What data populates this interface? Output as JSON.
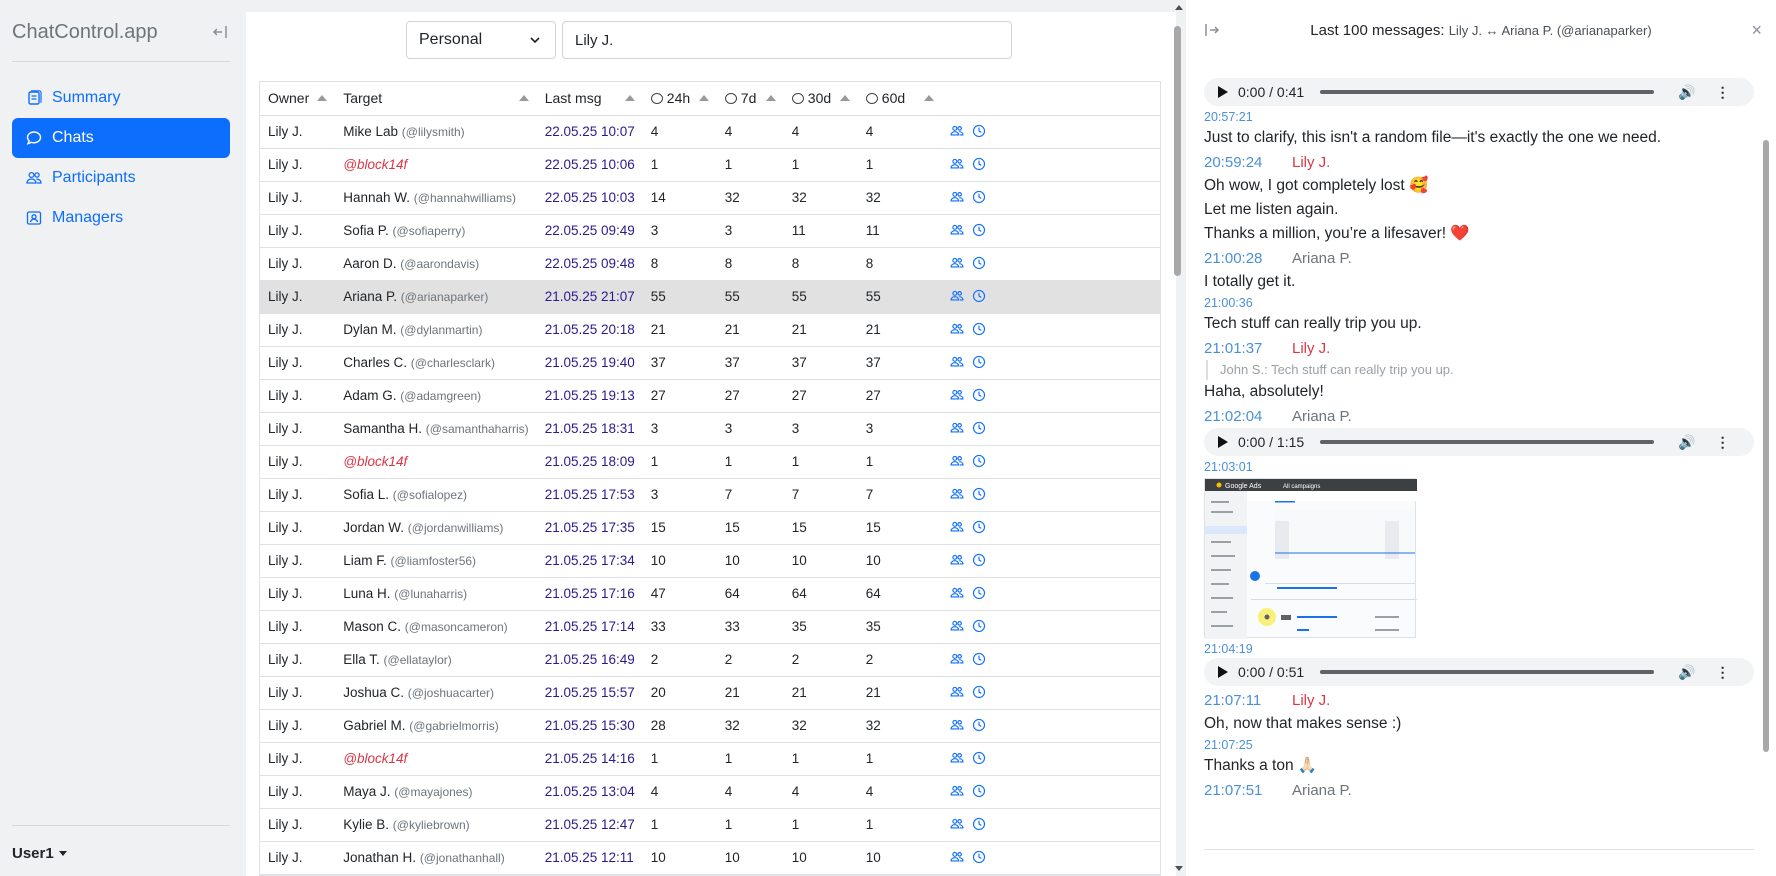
{
  "app": {
    "brand": "ChatControl.app",
    "user": "User1"
  },
  "nav": [
    {
      "label": "Summary",
      "icon": "summary-icon",
      "active": false
    },
    {
      "label": "Chats",
      "icon": "chat-icon",
      "active": true
    },
    {
      "label": "Participants",
      "icon": "participants-icon",
      "active": false
    },
    {
      "label": "Managers",
      "icon": "managers-icon",
      "active": false
    }
  ],
  "filters": {
    "type_value": "Personal",
    "owner_value": "Lily J."
  },
  "table": {
    "headers": {
      "owner": "Owner",
      "target": "Target",
      "last": "Last msg",
      "h24": "24h",
      "d7": "7d",
      "d30": "30d",
      "d60": "60d"
    },
    "rows": [
      {
        "owner": "Lily J.",
        "name": "Mike Lab",
        "handle": "(@lilysmith)",
        "blocked": false,
        "last": "22.05.25 10:07",
        "h24": "4",
        "d7": "4",
        "d30": "4",
        "d60": "4"
      },
      {
        "owner": "Lily J.",
        "name": "@block14f",
        "handle": "",
        "blocked": true,
        "last": "22.05.25 10:06",
        "h24": "1",
        "d7": "1",
        "d30": "1",
        "d60": "1"
      },
      {
        "owner": "Lily J.",
        "name": "Hannah W.",
        "handle": "(@hannahwilliams)",
        "blocked": false,
        "last": "22.05.25 10:03",
        "h24": "14",
        "d7": "32",
        "d30": "32",
        "d60": "32"
      },
      {
        "owner": "Lily J.",
        "name": "Sofia P.",
        "handle": "(@sofiaperry)",
        "blocked": false,
        "last": "22.05.25 09:49",
        "h24": "3",
        "d7": "3",
        "d30": "11",
        "d60": "11"
      },
      {
        "owner": "Lily J.",
        "name": "Aaron D.",
        "handle": "(@aarondavis)",
        "blocked": false,
        "last": "22.05.25 09:48",
        "h24": "8",
        "d7": "8",
        "d30": "8",
        "d60": "8"
      },
      {
        "owner": "Lily J.",
        "name": "Ariana P.",
        "handle": "(@arianaparker)",
        "blocked": false,
        "last": "21.05.25 21:07",
        "h24": "55",
        "d7": "55",
        "d30": "55",
        "d60": "55",
        "selected": true
      },
      {
        "owner": "Lily J.",
        "name": "Dylan M.",
        "handle": "(@dylanmartin)",
        "blocked": false,
        "last": "21.05.25 20:18",
        "h24": "21",
        "d7": "21",
        "d30": "21",
        "d60": "21"
      },
      {
        "owner": "Lily J.",
        "name": "Charles C.",
        "handle": "(@charlesclark)",
        "blocked": false,
        "last": "21.05.25 19:40",
        "h24": "37",
        "d7": "37",
        "d30": "37",
        "d60": "37"
      },
      {
        "owner": "Lily J.",
        "name": "Adam G.",
        "handle": "(@adamgreen)",
        "blocked": false,
        "last": "21.05.25 19:13",
        "h24": "27",
        "d7": "27",
        "d30": "27",
        "d60": "27"
      },
      {
        "owner": "Lily J.",
        "name": "Samantha H.",
        "handle": "(@samanthaharris)",
        "blocked": false,
        "last": "21.05.25 18:31",
        "h24": "3",
        "d7": "3",
        "d30": "3",
        "d60": "3"
      },
      {
        "owner": "Lily J.",
        "name": "@block14f",
        "handle": "",
        "blocked": true,
        "last": "21.05.25 18:09",
        "h24": "1",
        "d7": "1",
        "d30": "1",
        "d60": "1"
      },
      {
        "owner": "Lily J.",
        "name": "Sofia L.",
        "handle": "(@sofialopez)",
        "blocked": false,
        "last": "21.05.25 17:53",
        "h24": "3",
        "d7": "7",
        "d30": "7",
        "d60": "7"
      },
      {
        "owner": "Lily J.",
        "name": "Jordan W.",
        "handle": "(@jordanwilliams)",
        "blocked": false,
        "last": "21.05.25 17:35",
        "h24": "15",
        "d7": "15",
        "d30": "15",
        "d60": "15"
      },
      {
        "owner": "Lily J.",
        "name": "Liam F.",
        "handle": "(@liamfoster56)",
        "blocked": false,
        "last": "21.05.25 17:34",
        "h24": "10",
        "d7": "10",
        "d30": "10",
        "d60": "10"
      },
      {
        "owner": "Lily J.",
        "name": "Luna H.",
        "handle": "(@lunaharris)",
        "blocked": false,
        "last": "21.05.25 17:16",
        "h24": "47",
        "d7": "64",
        "d30": "64",
        "d60": "64"
      },
      {
        "owner": "Lily J.",
        "name": "Mason C.",
        "handle": "(@masoncameron)",
        "blocked": false,
        "last": "21.05.25 17:14",
        "h24": "33",
        "d7": "33",
        "d30": "35",
        "d60": "35"
      },
      {
        "owner": "Lily J.",
        "name": "Ella T.",
        "handle": "(@ellataylor)",
        "blocked": false,
        "last": "21.05.25 16:49",
        "h24": "2",
        "d7": "2",
        "d30": "2",
        "d60": "2"
      },
      {
        "owner": "Lily J.",
        "name": "Joshua C.",
        "handle": "(@joshuacarter)",
        "blocked": false,
        "last": "21.05.25 15:57",
        "h24": "20",
        "d7": "21",
        "d30": "21",
        "d60": "21"
      },
      {
        "owner": "Lily J.",
        "name": "Gabriel M.",
        "handle": "(@gabrielmorris)",
        "blocked": false,
        "last": "21.05.25 15:30",
        "h24": "28",
        "d7": "32",
        "d30": "32",
        "d60": "32"
      },
      {
        "owner": "Lily J.",
        "name": "@block14f",
        "handle": "",
        "blocked": true,
        "last": "21.05.25 14:16",
        "h24": "1",
        "d7": "1",
        "d30": "1",
        "d60": "1"
      },
      {
        "owner": "Lily J.",
        "name": "Maya J.",
        "handle": "(@mayajones)",
        "blocked": false,
        "last": "21.05.25 13:04",
        "h24": "4",
        "d7": "4",
        "d30": "4",
        "d60": "4"
      },
      {
        "owner": "Lily J.",
        "name": "Kylie B.",
        "handle": "(@kyliebrown)",
        "blocked": false,
        "last": "21.05.25 12:47",
        "h24": "1",
        "d7": "1",
        "d30": "1",
        "d60": "1"
      },
      {
        "owner": "Lily J.",
        "name": "Jonathan H.",
        "handle": "(@jonathanhall)",
        "blocked": false,
        "last": "21.05.25 12:11",
        "h24": "10",
        "d7": "10",
        "d30": "10",
        "d60": "10"
      }
    ]
  },
  "panel": {
    "title_prefix": "Last 100 messages:",
    "title_people": "Lily J. ↔ Ariana P. (@arianaparker)",
    "audio1": {
      "time": "0:00 / 0:41"
    },
    "audio2": {
      "time": "0:00 / 1:15"
    },
    "audio3": {
      "time": "0:00 / 0:51"
    },
    "m": {
      "t1": "20:57:21",
      "txt1": "Just to clarify, this isn't a random file—it's exactly the one we need.",
      "t2": "20:59:24",
      "w2": "Lily J.",
      "txt2a": "Oh wow, I got completely lost 🥰",
      "txt2b": "Let me listen again.",
      "txt2c": "Thanks a million, you’re a lifesaver! ❤️",
      "t3": "21:00:28",
      "w3": "Ariana P.",
      "txt3": "I totally get it.",
      "t4": "21:00:36",
      "txt4": "Tech stuff can really trip you up.",
      "t5": "21:01:37",
      "w5": "Lily J.",
      "quote5": "John S.: Tech stuff can really trip you up.",
      "txt5": "Haha, absolutely!",
      "t6": "21:02:04",
      "w6": "Ariana P.",
      "t7": "21:03:01",
      "img_top": "Google Ads",
      "img_tab": "All campaigns",
      "t8": "21:04:19",
      "t9": "21:07:11",
      "w9": "Lily J.",
      "txt9": "Oh, now that makes sense :)",
      "t10": "21:07:25",
      "txt10": "Thanks a ton 🙏🏻",
      "t11": "21:07:51",
      "w11": "Ariana P."
    }
  }
}
